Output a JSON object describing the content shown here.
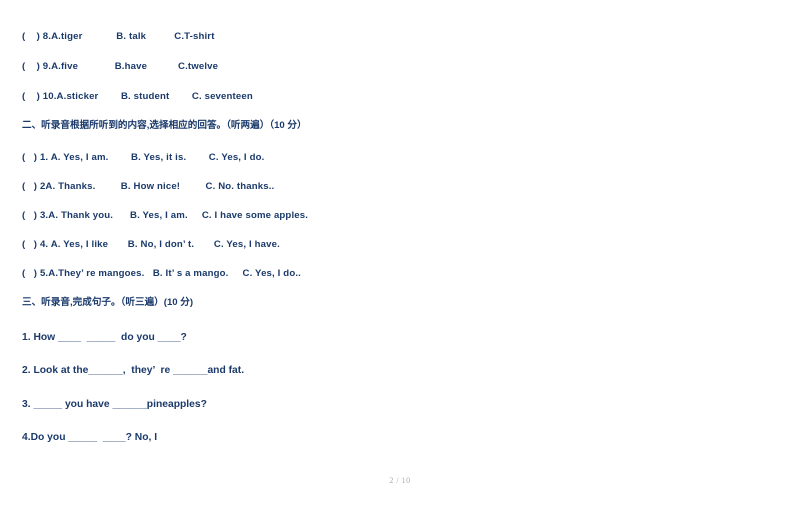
{
  "document": {
    "page_label": "2 / 10",
    "text_color": "#1b3a6b",
    "footer_color": "#a9a9a9",
    "background": "#ffffff"
  },
  "section_one_tail": {
    "items": [
      "(    ) 8.A.tiger            B. talk          C.T-shirt",
      "(    ) 9.A.five             B.have           C.twelve",
      "(    ) 10.A.sticker        B. student        C. seventeen"
    ]
  },
  "section_two": {
    "heading": "二、听录音根据所听到的内容,选择相应的回答。（听两遍）（10 分）",
    "items": [
      "(   ) 1. A. Yes, I am.        B. Yes, it is.        C. Yes, I do.",
      "(   ) 2A. Thanks.         B. How nice!         C. No. thanks..",
      "(   ) 3.A. Thank you.      B. Yes, I am.     C. I have some apples.",
      "(   ) 4. A. Yes, I like       B. No, I don’ t.       C. Yes, I have.",
      "(   ) 5.A.They’ re mangoes.   B. It’ s a mango.     C. Yes, I do.."
    ]
  },
  "section_three": {
    "heading": "三、听录音,完成句子。（听三遍）(10 分)",
    "items": [
      "1. How ____  _____  do you ____?",
      "2. Look at the______,  they’  re ______and fat.",
      "3. _____ you have ______pineapples?",
      "4.Do you _____  ____? No, I"
    ]
  }
}
